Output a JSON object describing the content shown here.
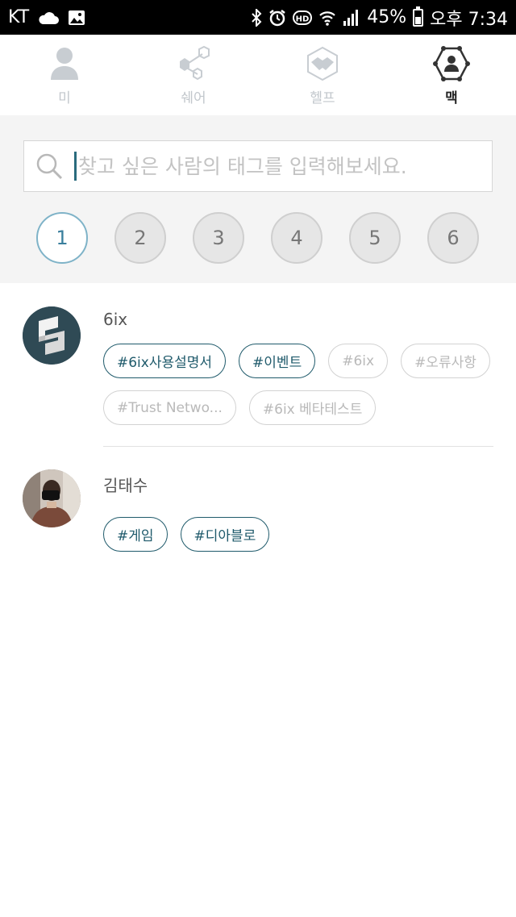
{
  "status_bar": {
    "carrier": "KT",
    "battery": "45%",
    "time": "오후 7:34",
    "battery_level": 0.45,
    "icons": [
      "cloud-icon",
      "image-icon",
      "bluetooth-icon",
      "alarm-icon",
      "hd-icon",
      "wifi-icon",
      "signal-icon",
      "battery-icon"
    ]
  },
  "nav": {
    "tabs": [
      {
        "label": "미",
        "icon": "person-icon",
        "active": false
      },
      {
        "label": "쉐어",
        "icon": "share-icon",
        "active": false
      },
      {
        "label": "헬프",
        "icon": "handshake-icon",
        "active": false
      },
      {
        "label": "맥",
        "icon": "network-person-icon",
        "active": true
      }
    ]
  },
  "search": {
    "placeholder": "찾고 싶은 사람의 태그를 입력해보세요.",
    "value": ""
  },
  "pages": {
    "items": [
      "1",
      "2",
      "3",
      "4",
      "5",
      "6"
    ],
    "selected": "1"
  },
  "people": [
    {
      "name": "6ix",
      "avatar": "6ix-logo-avatar",
      "tags": [
        {
          "text": "#6ix사용설명서",
          "highlighted": true
        },
        {
          "text": "#이벤트",
          "highlighted": true
        },
        {
          "text": "#6ix",
          "highlighted": false
        },
        {
          "text": "#오류사항",
          "highlighted": false
        },
        {
          "text": "#Trust Netwo...",
          "highlighted": false
        },
        {
          "text": "#6ix 베타테스트",
          "highlighted": false
        }
      ]
    },
    {
      "name": "김태수",
      "avatar": "photo-avatar",
      "tags": [
        {
          "text": "#게임",
          "highlighted": true
        },
        {
          "text": "#디아블로",
          "highlighted": true
        }
      ]
    }
  ],
  "colors": {
    "accent": "#1f5a6b",
    "active_page_border": "#7fb3c8",
    "muted_tag": "#b9b9b9",
    "section_bg": "#f4f4f4"
  }
}
